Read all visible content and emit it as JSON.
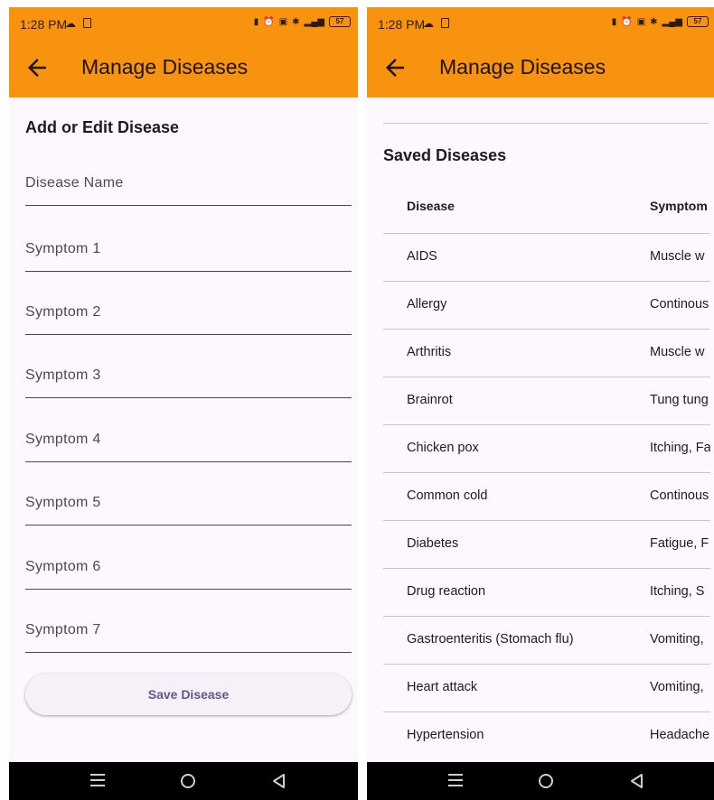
{
  "status_bar": {
    "time": "1:28 PM",
    "battery": "57"
  },
  "left": {
    "title": "Manage Diseases",
    "form_title": "Add or Edit Disease",
    "fields": [
      "Disease Name",
      "Symptom 1",
      "Symptom 2",
      "Symptom 3",
      "Symptom 4",
      "Symptom 5",
      "Symptom 6",
      "Symptom 7"
    ],
    "save_label": "Save Disease"
  },
  "right": {
    "title": "Manage Diseases",
    "section_title": "Saved Diseases",
    "columns": {
      "disease": "Disease",
      "symptoms": "Symptom"
    },
    "rows": [
      {
        "disease": "AIDS",
        "symptoms": "Muscle w"
      },
      {
        "disease": "Allergy",
        "symptoms": "Continous"
      },
      {
        "disease": "Arthritis",
        "symptoms": "Muscle w"
      },
      {
        "disease": "Brainrot",
        "symptoms": "Tung tung"
      },
      {
        "disease": "Chicken pox",
        "symptoms": "Itching, Fa"
      },
      {
        "disease": "Common cold",
        "symptoms": "Continous"
      },
      {
        "disease": "Diabetes",
        "symptoms": "Fatigue, F"
      },
      {
        "disease": "Drug reaction",
        "symptoms": "Itching, S"
      },
      {
        "disease": "Gastroenteritis (Stomach flu)",
        "symptoms": "Vomiting,"
      },
      {
        "disease": "Heart attack",
        "symptoms": "Vomiting,"
      },
      {
        "disease": "Hypertension",
        "symptoms": "Headache"
      }
    ]
  },
  "icons": {
    "back": "arrow-left-icon",
    "nav_recents": "menu-lines-icon",
    "nav_home": "circle-home-icon",
    "nav_back": "triangle-back-icon"
  },
  "colors": {
    "appbar": "#f7930e",
    "background": "#fdf7fe",
    "button_text": "#65558f"
  }
}
